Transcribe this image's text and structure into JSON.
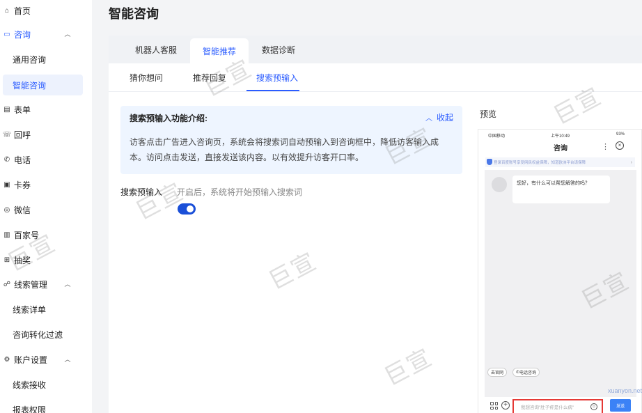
{
  "sidebar": {
    "items": [
      {
        "label": "首页",
        "icon": "home-icon"
      },
      {
        "label": "咨询",
        "icon": "chat-icon"
      },
      {
        "label": "通用咨询"
      },
      {
        "label": "智能咨询"
      },
      {
        "label": "表单",
        "icon": "form-icon"
      },
      {
        "label": "回呼",
        "icon": "callback-icon"
      },
      {
        "label": "电话",
        "icon": "phone-icon"
      },
      {
        "label": "卡券",
        "icon": "coupon-icon"
      },
      {
        "label": "微信",
        "icon": "wechat-icon"
      },
      {
        "label": "百家号",
        "icon": "baijiahao-icon"
      },
      {
        "label": "抽奖",
        "icon": "lottery-icon"
      },
      {
        "label": "线索管理",
        "icon": "leads-icon"
      },
      {
        "label": "线索详单"
      },
      {
        "label": "咨询转化过滤"
      },
      {
        "label": "账户设置",
        "icon": "settings-icon"
      },
      {
        "label": "线索接收"
      },
      {
        "label": "报表权限"
      }
    ]
  },
  "page": {
    "title": "智能咨询"
  },
  "top_tabs": [
    {
      "label": "机器人客服"
    },
    {
      "label": "智能推荐"
    },
    {
      "label": "数据诊断"
    }
  ],
  "sub_tabs": [
    {
      "label": "猜你想问"
    },
    {
      "label": "推荐回复"
    },
    {
      "label": "搜索预输入"
    }
  ],
  "info_box": {
    "title": "搜索预输入功能介绍:",
    "collapse_label": "收起",
    "text": "访客点击广告进入咨询页，系统会将搜索词自动预输入到咨询框中，降低访客输入成本。访问点击发送，直接发送该内容。以有效提升访客开口率。"
  },
  "switch": {
    "label": "搜索预输入",
    "hint": "开启后，系统将开始预输入搜索词",
    "enabled": true
  },
  "preview": {
    "label": "预览",
    "status_carrier": "中国移动",
    "status_time": "上午10:49",
    "status_battery": "93%",
    "chat_title": "咨询",
    "notice": "登录百度账号享受网民权益保障，知道欧洲平台请保障",
    "bot_message": "您好，有什么可以帮您解答的吗？",
    "quick_buttons": [
      {
        "label": "去官网"
      },
      {
        "label": "电话咨询"
      }
    ],
    "input_value": "我想咨询\"肚子疼是什么病\"",
    "send_label": "发送"
  },
  "watermark": {
    "text": "巨宣",
    "site": "xuanyon.net"
  },
  "colors": {
    "accent": "#2b5cff",
    "toggle": "#1a4fd8",
    "highlight": "#e53935"
  }
}
